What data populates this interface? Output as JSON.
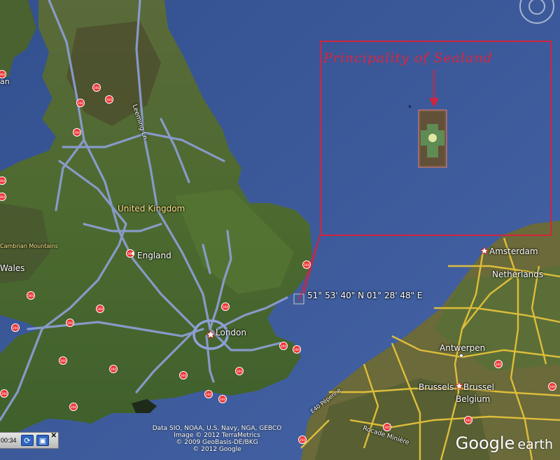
{
  "inset": {
    "title": "Principality of Sealand"
  },
  "coordinates": "51° 53' 40\" N 01° 28' 48\" E",
  "places": {
    "uk": "United Kingdom",
    "england": "England",
    "london": "London",
    "wales": "Wales",
    "cambrian": "Cambrian Mountains",
    "amsterdam": "Amsterdam",
    "netherlands": "Netherlands",
    "antwerpen": "Antwerpen",
    "brussels1": "Brussels",
    "brussels2": "Brussel",
    "belgium": "Belgium",
    "leeming": "Leeming Ln",
    "rocade": "Rocade Minière",
    "epenne": "E40 Pépenne",
    "an": "an"
  },
  "attribution": {
    "line1": "Data SIO, NOAA, U.S. Navy, NGA, GEBCO",
    "line2": "Image © 2012 TerraMetrics",
    "line3": "© 2009 GeoBasis-DE/BKG",
    "line4": "© 2012 Google"
  },
  "brand": {
    "word1": "Google",
    "word2": "earth"
  },
  "tour": {
    "time": "00:34"
  },
  "icons": {
    "marker": "360-marker-icon",
    "star": "capital-star-icon"
  },
  "colors": {
    "sea": "#3d5a9a",
    "land": "#4f6a33",
    "motorway": "#8ea0d8",
    "road": "#e5c23b",
    "annotation": "#d2243d"
  }
}
